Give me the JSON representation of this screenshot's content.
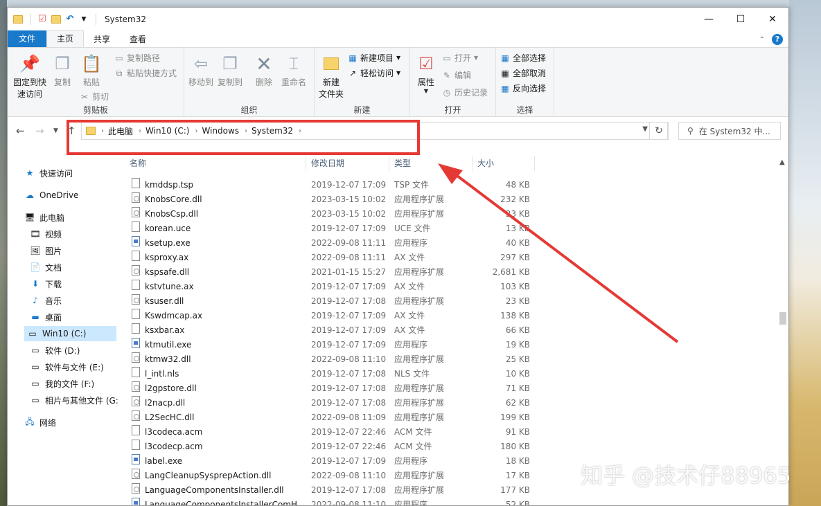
{
  "window": {
    "title": "System32",
    "controls": {
      "minimize": "—",
      "maximize": "☐",
      "close": "✕"
    }
  },
  "ribbon_tabs": [
    {
      "label": "文件"
    },
    {
      "label": "主页"
    },
    {
      "label": "共享"
    },
    {
      "label": "查看"
    }
  ],
  "ribbon": {
    "groups": {
      "clipboard": "剪贴板",
      "organize": "组织",
      "new": "新建",
      "open": "打开",
      "select": "选择"
    },
    "pin_quick_access": "固定到快",
    "pin_quick_access_2": "速访问",
    "copy": "复制",
    "paste": "粘贴",
    "copy_path": "复制路径",
    "paste_shortcut": "粘贴快捷方式",
    "cut": "剪切",
    "move_to": "移动到",
    "copy_to": "复制到",
    "delete": "删除",
    "rename": "重命名",
    "new_folder": "新建",
    "new_folder_2": "文件夹",
    "new_item": "新建项目",
    "easy_access": "轻松访问",
    "properties": "属性",
    "open": "打开",
    "edit": "编辑",
    "history": "历史记录",
    "select_all": "全部选择",
    "select_none": "全部取消",
    "invert_selection": "反向选择"
  },
  "address_bar": {
    "crumbs": [
      "此电脑",
      "Win10 (C:)",
      "Windows",
      "System32"
    ]
  },
  "search": {
    "placeholder": "在 System32 中..."
  },
  "nav_pane": [
    {
      "label": "快速访问",
      "icon": "star-icon"
    },
    {
      "label": "OneDrive",
      "icon": "cloud-icon"
    },
    {
      "label": "此电脑",
      "icon": "computer-icon"
    },
    {
      "label": "视频",
      "icon": "video-icon"
    },
    {
      "label": "图片",
      "icon": "picture-icon"
    },
    {
      "label": "文档",
      "icon": "document-icon"
    },
    {
      "label": "下载",
      "icon": "download-icon"
    },
    {
      "label": "音乐",
      "icon": "music-icon"
    },
    {
      "label": "桌面",
      "icon": "desktop-icon"
    },
    {
      "label": "Win10 (C:)",
      "icon": "drive-icon"
    },
    {
      "label": "软件 (D:)",
      "icon": "drive-icon"
    },
    {
      "label": "软件与文件 (E:)",
      "icon": "drive-icon"
    },
    {
      "label": "我的文件 (F:)",
      "icon": "drive-icon"
    },
    {
      "label": "相片与其他文件 (G:",
      "icon": "drive-icon"
    },
    {
      "label": "网络",
      "icon": "network-icon"
    }
  ],
  "columns": {
    "name": "名称",
    "date": "修改日期",
    "type": "类型",
    "size": "大小"
  },
  "files": [
    {
      "name": "kmddsp.tsp",
      "date": "2019-12-07 17:09",
      "type": "TSP 文件",
      "size": "48 KB",
      "kind": "file"
    },
    {
      "name": "KnobsCore.dll",
      "date": "2023-03-15 10:02",
      "type": "应用程序扩展",
      "size": "232 KB",
      "kind": "dll"
    },
    {
      "name": "KnobsCsp.dll",
      "date": "2023-03-15 10:02",
      "type": "应用程序扩展",
      "size": "23 KB",
      "kind": "dll"
    },
    {
      "name": "korean.uce",
      "date": "2019-12-07 17:09",
      "type": "UCE 文件",
      "size": "13 KB",
      "kind": "file"
    },
    {
      "name": "ksetup.exe",
      "date": "2022-09-08 11:11",
      "type": "应用程序",
      "size": "40 KB",
      "kind": "exe"
    },
    {
      "name": "ksproxy.ax",
      "date": "2022-09-08 11:11",
      "type": "AX 文件",
      "size": "297 KB",
      "kind": "file"
    },
    {
      "name": "kspsafe.dll",
      "date": "2021-01-15 15:27",
      "type": "应用程序扩展",
      "size": "2,681 KB",
      "kind": "dll"
    },
    {
      "name": "kstvtune.ax",
      "date": "2019-12-07 17:09",
      "type": "AX 文件",
      "size": "103 KB",
      "kind": "file"
    },
    {
      "name": "ksuser.dll",
      "date": "2019-12-07 17:08",
      "type": "应用程序扩展",
      "size": "23 KB",
      "kind": "dll"
    },
    {
      "name": "Kswdmcap.ax",
      "date": "2019-12-07 17:09",
      "type": "AX 文件",
      "size": "138 KB",
      "kind": "file"
    },
    {
      "name": "ksxbar.ax",
      "date": "2019-12-07 17:09",
      "type": "AX 文件",
      "size": "66 KB",
      "kind": "file"
    },
    {
      "name": "ktmutil.exe",
      "date": "2019-12-07 17:09",
      "type": "应用程序",
      "size": "19 KB",
      "kind": "exe"
    },
    {
      "name": "ktmw32.dll",
      "date": "2022-09-08 11:10",
      "type": "应用程序扩展",
      "size": "25 KB",
      "kind": "dll"
    },
    {
      "name": "l_intl.nls",
      "date": "2019-12-07 17:08",
      "type": "NLS 文件",
      "size": "10 KB",
      "kind": "file"
    },
    {
      "name": "l2gpstore.dll",
      "date": "2019-12-07 17:08",
      "type": "应用程序扩展",
      "size": "71 KB",
      "kind": "dll"
    },
    {
      "name": "l2nacp.dll",
      "date": "2019-12-07 17:08",
      "type": "应用程序扩展",
      "size": "62 KB",
      "kind": "dll"
    },
    {
      "name": "L2SecHC.dll",
      "date": "2022-09-08 11:09",
      "type": "应用程序扩展",
      "size": "199 KB",
      "kind": "dll"
    },
    {
      "name": "l3codeca.acm",
      "date": "2019-12-07 22:46",
      "type": "ACM 文件",
      "size": "91 KB",
      "kind": "file"
    },
    {
      "name": "l3codecp.acm",
      "date": "2019-12-07 22:46",
      "type": "ACM 文件",
      "size": "180 KB",
      "kind": "file"
    },
    {
      "name": "label.exe",
      "date": "2019-12-07 17:09",
      "type": "应用程序",
      "size": "18 KB",
      "kind": "exe"
    },
    {
      "name": "LangCleanupSysprepAction.dll",
      "date": "2022-09-08 11:10",
      "type": "应用程序扩展",
      "size": "17 KB",
      "kind": "dll"
    },
    {
      "name": "LanguageComponentsInstaller.dll",
      "date": "2019-12-07 17:08",
      "type": "应用程序扩展",
      "size": "177 KB",
      "kind": "dll"
    },
    {
      "name": "LanguageComponentsInstallerComH...",
      "date": "2022-09-08 11:10",
      "type": "应用程序",
      "size": "52 KB",
      "kind": "exe"
    }
  ],
  "annotation": {
    "watermark": "知乎 @技术仔88965",
    "highlight_color": "#e53935"
  }
}
